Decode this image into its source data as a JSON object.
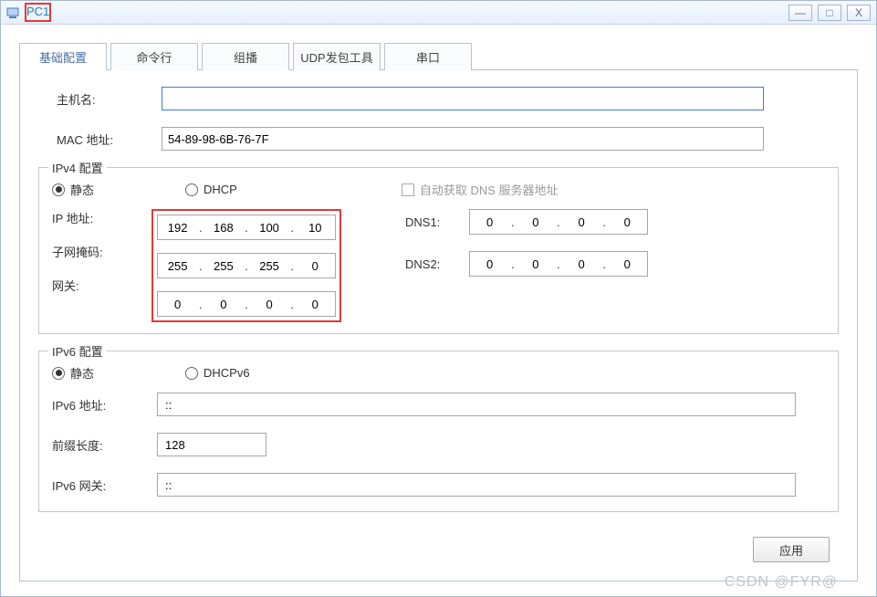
{
  "window": {
    "title": "PC1"
  },
  "tabs": {
    "basic": "基础配置",
    "cli": "命令行",
    "multicast": "组播",
    "udp": "UDP发包工具",
    "serial": "串口"
  },
  "labels": {
    "hostname": "主机名:",
    "mac": "MAC 地址:",
    "ipv4_section": "IPv4 配置",
    "static": "静态",
    "dhcp": "DHCP",
    "auto_dns": "自动获取 DNS 服务器地址",
    "ip": "IP 地址:",
    "mask": "子网掩码:",
    "gateway": "网关:",
    "dns1": "DNS1:",
    "dns2": "DNS2:",
    "ipv6_section": "IPv6 配置",
    "dhcpv6": "DHCPv6",
    "ipv6_addr": "IPv6 地址:",
    "prefix": "前缀长度:",
    "ipv6_gw": "IPv6 网关:",
    "apply": "应用"
  },
  "values": {
    "hostname": "",
    "mac": "54-89-98-6B-76-7F",
    "ip": [
      "192",
      "168",
      "100",
      "10"
    ],
    "mask": [
      "255",
      "255",
      "255",
      "0"
    ],
    "gateway": [
      "0",
      "0",
      "0",
      "0"
    ],
    "dns1": [
      "0",
      "0",
      "0",
      "0"
    ],
    "dns2": [
      "0",
      "0",
      "0",
      "0"
    ],
    "ipv6_addr": "::",
    "prefix": "128",
    "ipv6_gw": "::"
  },
  "watermark": "CSDN @FYR@"
}
